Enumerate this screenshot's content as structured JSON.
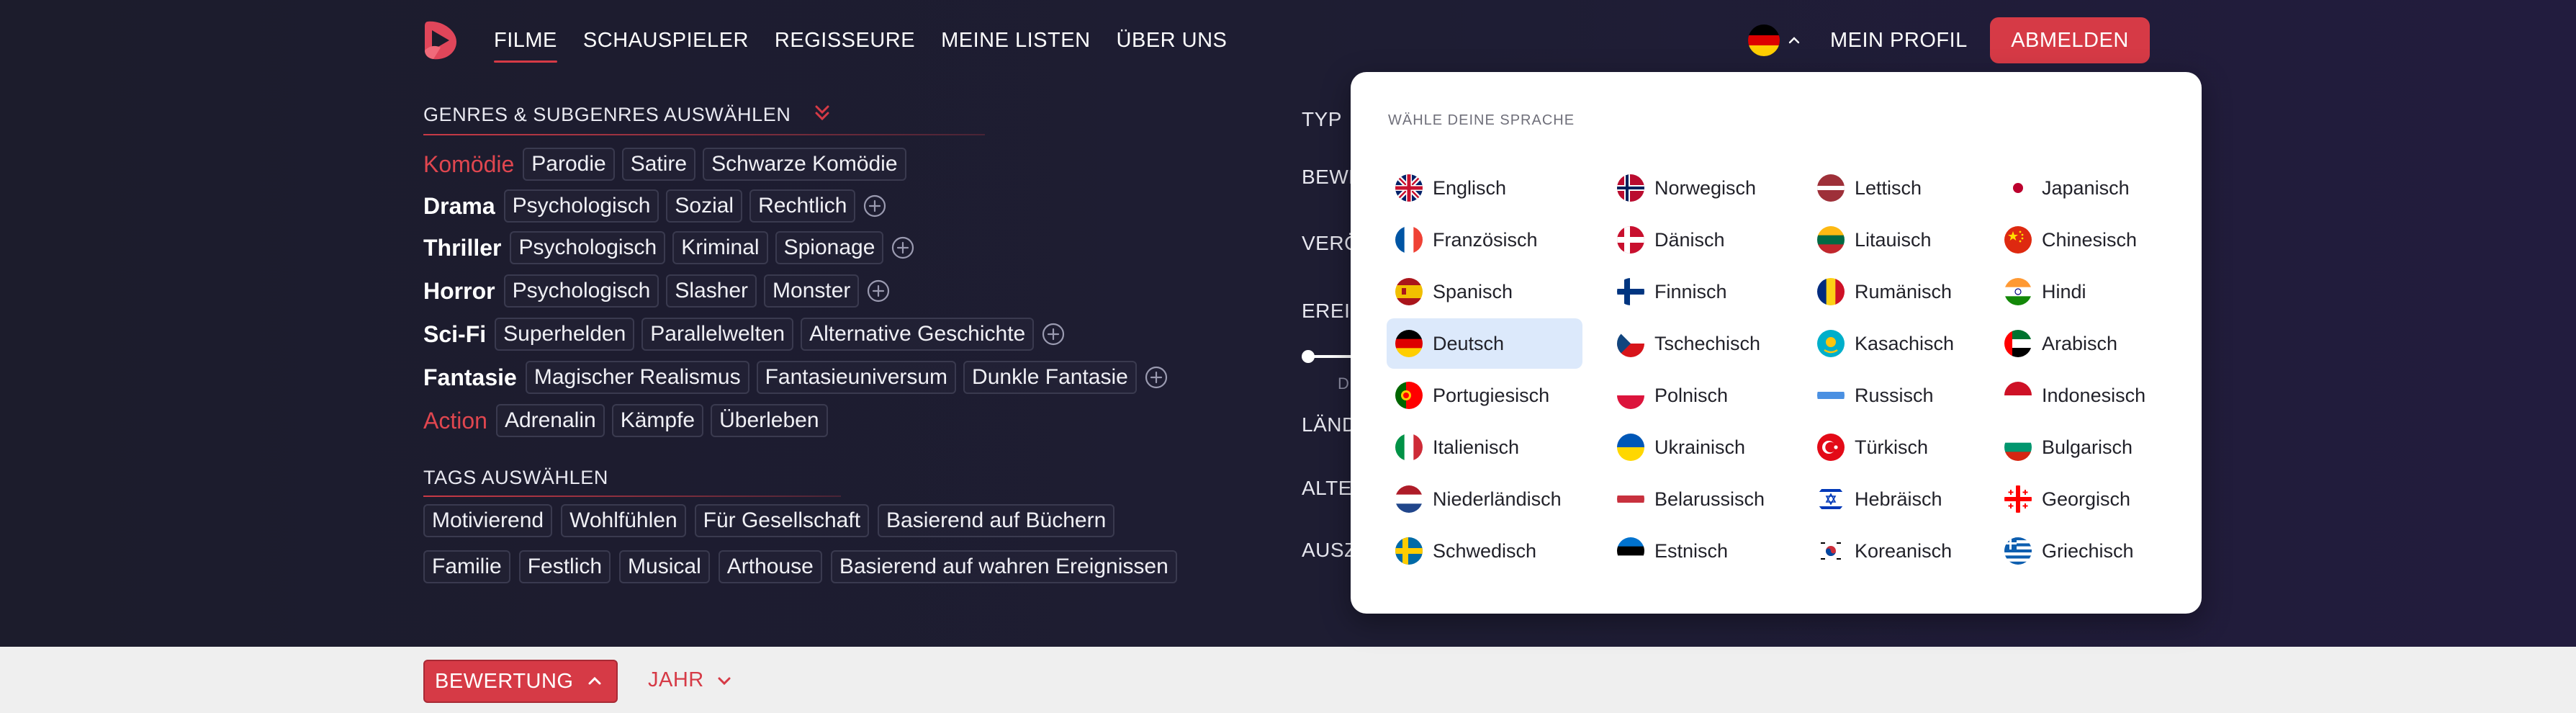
{
  "nav": {
    "links": [
      "FILME",
      "SCHAUSPIELER",
      "REGISSEURE",
      "MEINE LISTEN",
      "ÜBER UNS"
    ],
    "active_index": 0,
    "profile_label": "MEIN PROFIL",
    "logout_label": "ABMELDEN",
    "current_language_icon": "flag-de-icon"
  },
  "filters": {
    "genres_title": "GENRES & SUBGENRES AUSWÄHLEN",
    "genres": [
      {
        "name": "Komödie",
        "highlighted": true,
        "subgenres": [
          "Parodie",
          "Satire",
          "Schwarze Komödie"
        ],
        "has_add": false
      },
      {
        "name": "Drama",
        "highlighted": false,
        "subgenres": [
          "Psychologisch",
          "Sozial",
          "Rechtlich"
        ],
        "has_add": true
      },
      {
        "name": "Thriller",
        "highlighted": false,
        "subgenres": [
          "Psychologisch",
          "Kriminal",
          "Spionage"
        ],
        "has_add": true
      },
      {
        "name": "Horror",
        "highlighted": false,
        "subgenres": [
          "Psychologisch",
          "Slasher",
          "Monster"
        ],
        "has_add": true
      },
      {
        "name": "Sci-Fi",
        "highlighted": false,
        "subgenres": [
          "Superhelden",
          "Parallelwelten",
          "Alternative Geschichte"
        ],
        "has_add": true
      },
      {
        "name": "Fantasie",
        "highlighted": false,
        "subgenres": [
          "Magischer Realismus",
          "Fantasieuniversum",
          "Dunkle Fantasie"
        ],
        "has_add": true
      },
      {
        "name": "Action",
        "highlighted": true,
        "subgenres": [
          "Adrenalin",
          "Kämpfe",
          "Überleben"
        ],
        "has_add": false
      }
    ],
    "tags_title": "TAGS AUSWÄHLEN",
    "tags_rows": [
      [
        "Motivierend",
        "Wohlfühlen",
        "Für Gesellschaft",
        "Basierend auf Büchern"
      ],
      [
        "Familie",
        "Festlich",
        "Musical",
        "Arthouse",
        "Basierend auf wahren Ereignissen"
      ]
    ]
  },
  "middle_column": {
    "labels": [
      "TYP",
      "BEWE",
      "VERÖ",
      "EREIG",
      "LÄND",
      "ALTE",
      "AUSZ"
    ],
    "slider_caption": "D"
  },
  "sort": {
    "active_label": "BEWERTUNG",
    "secondary_label": "JAHR"
  },
  "language_dropdown": {
    "title": "WÄHLE DEINE SPRACHE",
    "selected": "Deutsch",
    "columns": [
      [
        {
          "name": "Englisch",
          "icon": "flag-gb-icon"
        },
        {
          "name": "Französisch",
          "icon": "flag-fr-icon"
        },
        {
          "name": "Spanisch",
          "icon": "flag-es-icon"
        },
        {
          "name": "Deutsch",
          "icon": "flag-de-icon"
        },
        {
          "name": "Portugiesisch",
          "icon": "flag-pt-icon"
        },
        {
          "name": "Italienisch",
          "icon": "flag-it-icon"
        },
        {
          "name": "Niederländisch",
          "icon": "flag-nl-icon"
        },
        {
          "name": "Schwedisch",
          "icon": "flag-se-icon"
        }
      ],
      [
        {
          "name": "Norwegisch",
          "icon": "flag-no-icon"
        },
        {
          "name": "Dänisch",
          "icon": "flag-dk-icon"
        },
        {
          "name": "Finnisch",
          "icon": "flag-fi-icon"
        },
        {
          "name": "Tschechisch",
          "icon": "flag-cz-icon"
        },
        {
          "name": "Polnisch",
          "icon": "flag-pl-icon"
        },
        {
          "name": "Ukrainisch",
          "icon": "flag-ua-icon"
        },
        {
          "name": "Belarussisch",
          "icon": "flag-by-icon"
        },
        {
          "name": "Estnisch",
          "icon": "flag-ee-icon"
        }
      ],
      [
        {
          "name": "Lettisch",
          "icon": "flag-lv-icon"
        },
        {
          "name": "Litauisch",
          "icon": "flag-lt-icon"
        },
        {
          "name": "Rumänisch",
          "icon": "flag-ro-icon"
        },
        {
          "name": "Kasachisch",
          "icon": "flag-kz-icon"
        },
        {
          "name": "Russisch",
          "icon": "flag-ru-icon"
        },
        {
          "name": "Türkisch",
          "icon": "flag-tr-icon"
        },
        {
          "name": "Hebräisch",
          "icon": "flag-il-icon"
        },
        {
          "name": "Koreanisch",
          "icon": "flag-kr-icon"
        }
      ],
      [
        {
          "name": "Japanisch",
          "icon": "flag-jp-icon"
        },
        {
          "name": "Chinesisch",
          "icon": "flag-cn-icon"
        },
        {
          "name": "Hindi",
          "icon": "flag-in-icon"
        },
        {
          "name": "Arabisch",
          "icon": "flag-ae-icon"
        },
        {
          "name": "Indonesisch",
          "icon": "flag-id-icon"
        },
        {
          "name": "Bulgarisch",
          "icon": "flag-bg-icon"
        },
        {
          "name": "Georgisch",
          "icon": "flag-ge-icon"
        },
        {
          "name": "Griechisch",
          "icon": "flag-gr-icon"
        }
      ]
    ]
  },
  "colors": {
    "accent": "#d63a46",
    "background_dark": "#1c1c2c",
    "selected_language_bg": "#dce9fb",
    "bottom_bar": "#efefef"
  }
}
